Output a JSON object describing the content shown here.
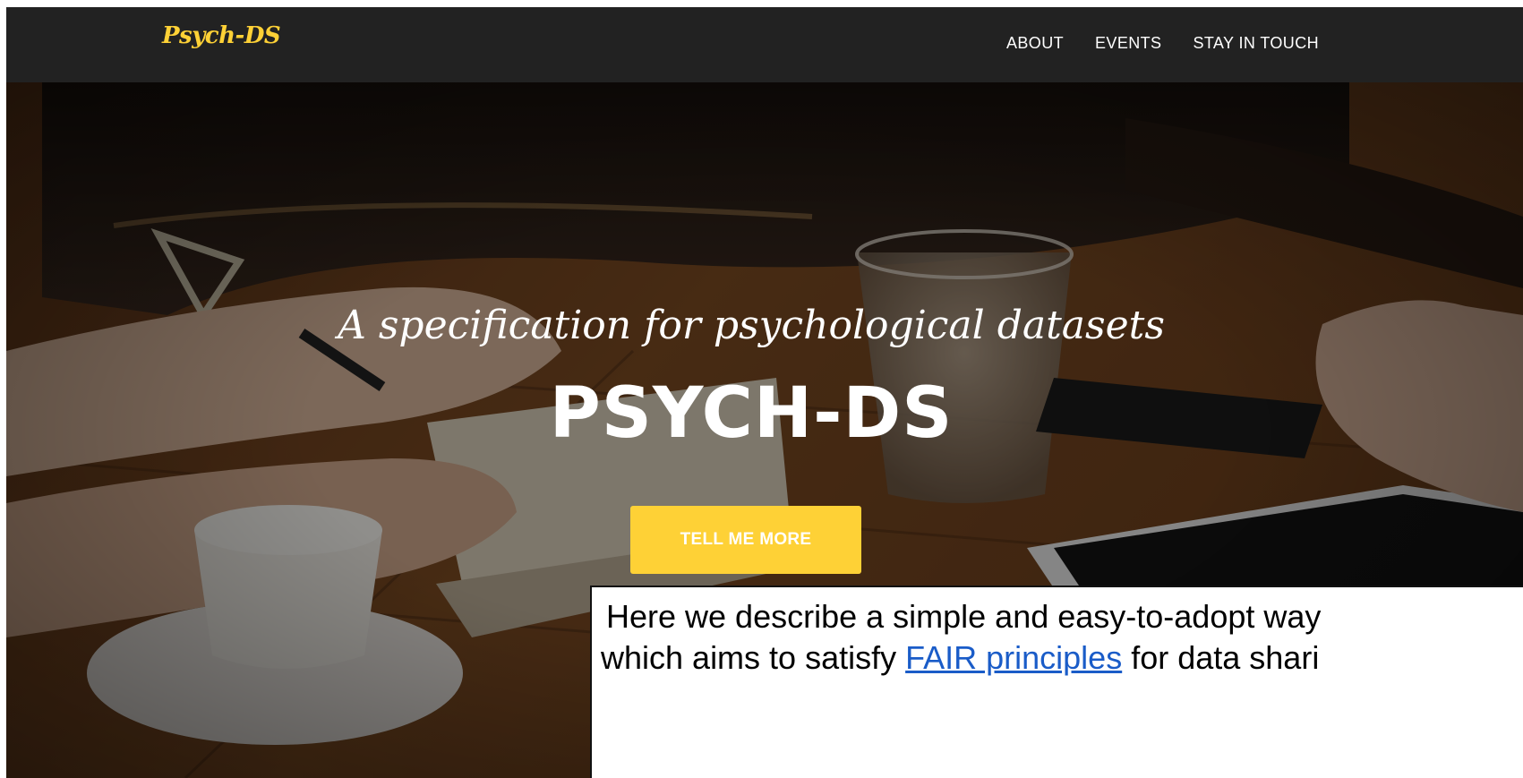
{
  "navbar": {
    "brand": "Psych-DS",
    "links": [
      "ABOUT",
      "EVENTS",
      "STAY IN TOUCH"
    ]
  },
  "hero": {
    "subtitle": "A specification for psychological datasets",
    "title": "PSYCH-DS",
    "cta_label": "TELL ME MORE"
  },
  "callout": {
    "line1": "Here we describe a simple and easy-to-adopt way",
    "line2_before": "which aims to satisfy ",
    "line2_link": "FAIR principles",
    "line2_after": " for data shari"
  },
  "colors": {
    "navbar_bg": "#222222",
    "brand": "#fed136",
    "cta_bg": "#fed136",
    "link": "#1a5cc8"
  }
}
